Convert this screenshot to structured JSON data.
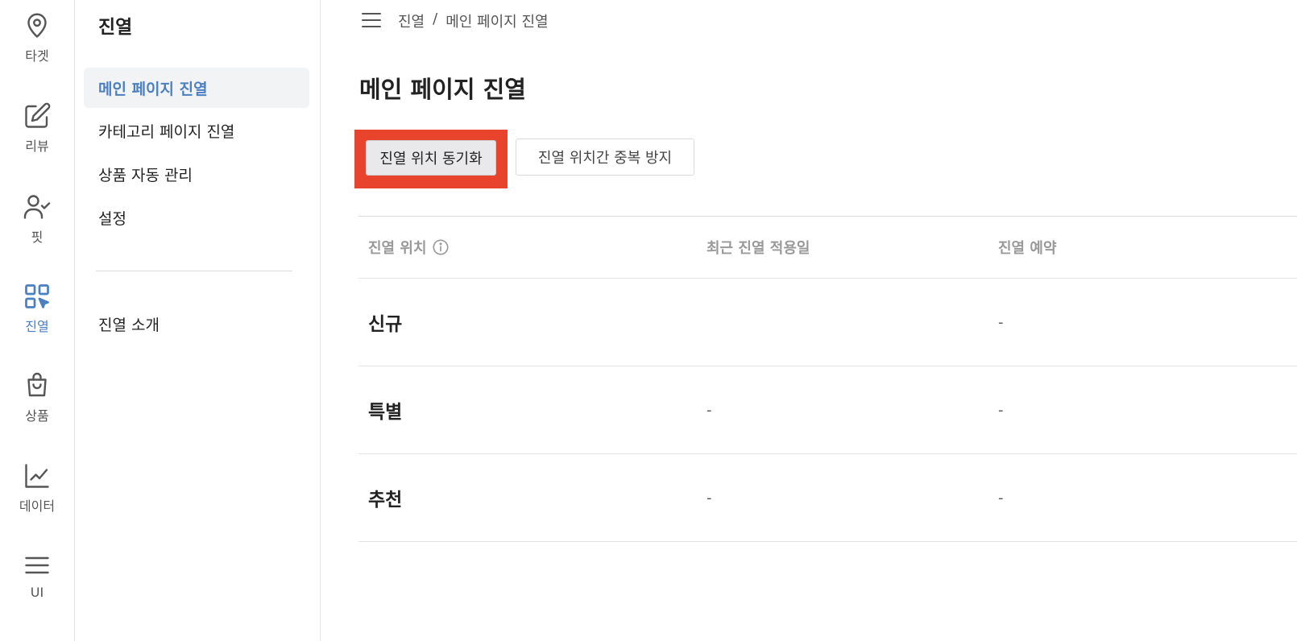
{
  "rail": [
    {
      "label": "타겟",
      "icon": "map-pin-icon"
    },
    {
      "label": "리뷰",
      "icon": "edit-icon"
    },
    {
      "label": "핏",
      "icon": "user-check-icon"
    },
    {
      "label": "진열",
      "icon": "grid-cursor-icon",
      "active": true
    },
    {
      "label": "상품",
      "icon": "shopping-bag-icon"
    },
    {
      "label": "데이터",
      "icon": "line-chart-icon"
    },
    {
      "label": "UI",
      "icon": "menu-icon"
    }
  ],
  "subnav": {
    "title": "진열",
    "items": [
      {
        "label": "메인 페이지 진열",
        "active": true
      },
      {
        "label": "카테고리 페이지 진열"
      },
      {
        "label": "상품 자동 관리"
      },
      {
        "label": "설정"
      },
      {
        "label": "진열 소개"
      }
    ]
  },
  "breadcrumb": {
    "parent": "진열",
    "separator": "/",
    "current": "메인 페이지 진열"
  },
  "page_title": "메인 페이지 진열",
  "buttons": {
    "sync": "진열 위치 동기화",
    "dedupe": "진열 위치간 중복 방지"
  },
  "table": {
    "headers": [
      "진열 위치",
      "최근 진열 적용일",
      "진열 예약"
    ],
    "rows": [
      {
        "name": "신규",
        "applied": "",
        "reservation": "-"
      },
      {
        "name": "특별",
        "applied": "-",
        "reservation": "-"
      },
      {
        "name": "추천",
        "applied": "-",
        "reservation": "-"
      }
    ]
  },
  "colors": {
    "accent": "#4a7fc1",
    "highlight": "#e8432d"
  }
}
